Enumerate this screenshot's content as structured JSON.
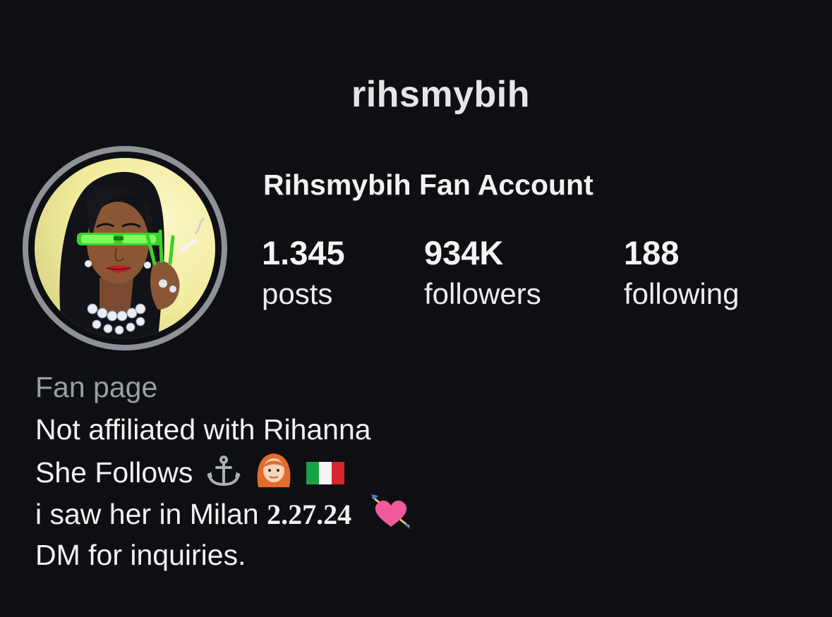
{
  "profile": {
    "username": "rihsmybih",
    "display_name": "Rihsmybih Fan Account",
    "avatar_icon": "illustrated-portrait-avatar"
  },
  "stats": {
    "posts": {
      "value": "1.345",
      "label": "posts"
    },
    "followers": {
      "value": "934K",
      "label": "followers"
    },
    "following": {
      "value": "188",
      "label": "following"
    }
  },
  "bio": {
    "category": "Fan page",
    "line1": "Not affiliated with Rihanna",
    "line2": "She Follows",
    "line2_icons": [
      "anchor-icon",
      "red-hair-person-icon",
      "italy-flag-icon"
    ],
    "line3_prefix": "i saw her in Milan",
    "line3_date": "2.27.24",
    "line3_icon": "heart-with-arrow-icon",
    "line4": "DM for inquiries."
  },
  "colors": {
    "background": "#0d0f12",
    "text": "#f2f2f2",
    "muted": "#9a9ea6",
    "avatar_ring": "#8e9198"
  }
}
